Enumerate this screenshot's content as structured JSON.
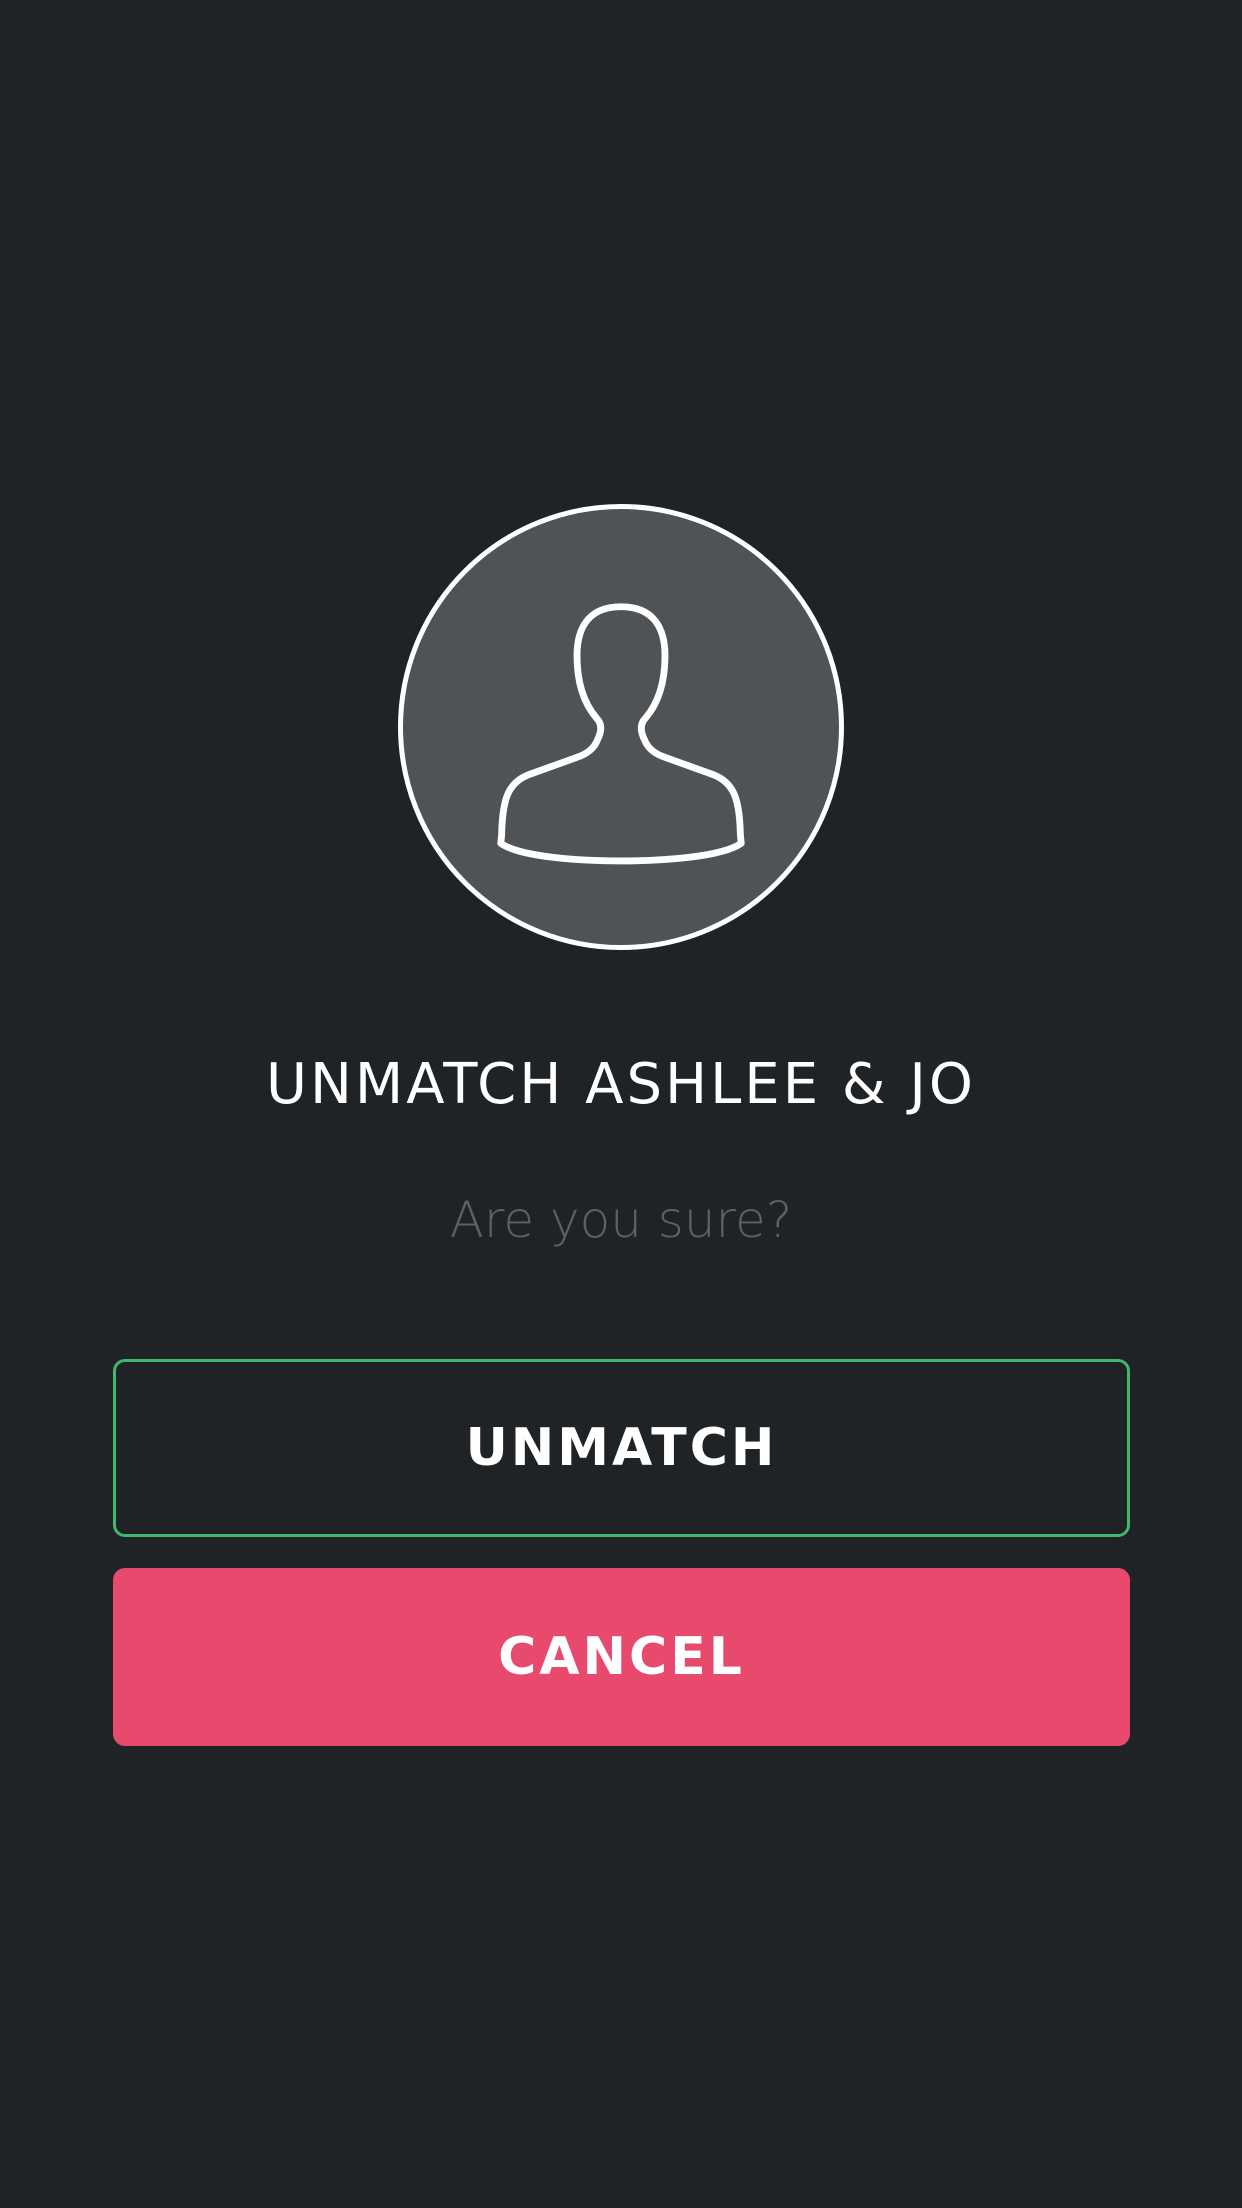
{
  "dialog": {
    "avatar_icon": "person-silhouette-icon",
    "title": "UNMATCH ASHLEE & JO",
    "subtitle": "Are you sure?",
    "confirm_label": "UNMATCH",
    "cancel_label": "CANCEL"
  },
  "colors": {
    "background": "#202326",
    "avatar_fill": "#4f5355",
    "confirm_border": "#3fb86d",
    "cancel_fill": "#e74a6c",
    "subtitle_text": "#5d6164"
  }
}
